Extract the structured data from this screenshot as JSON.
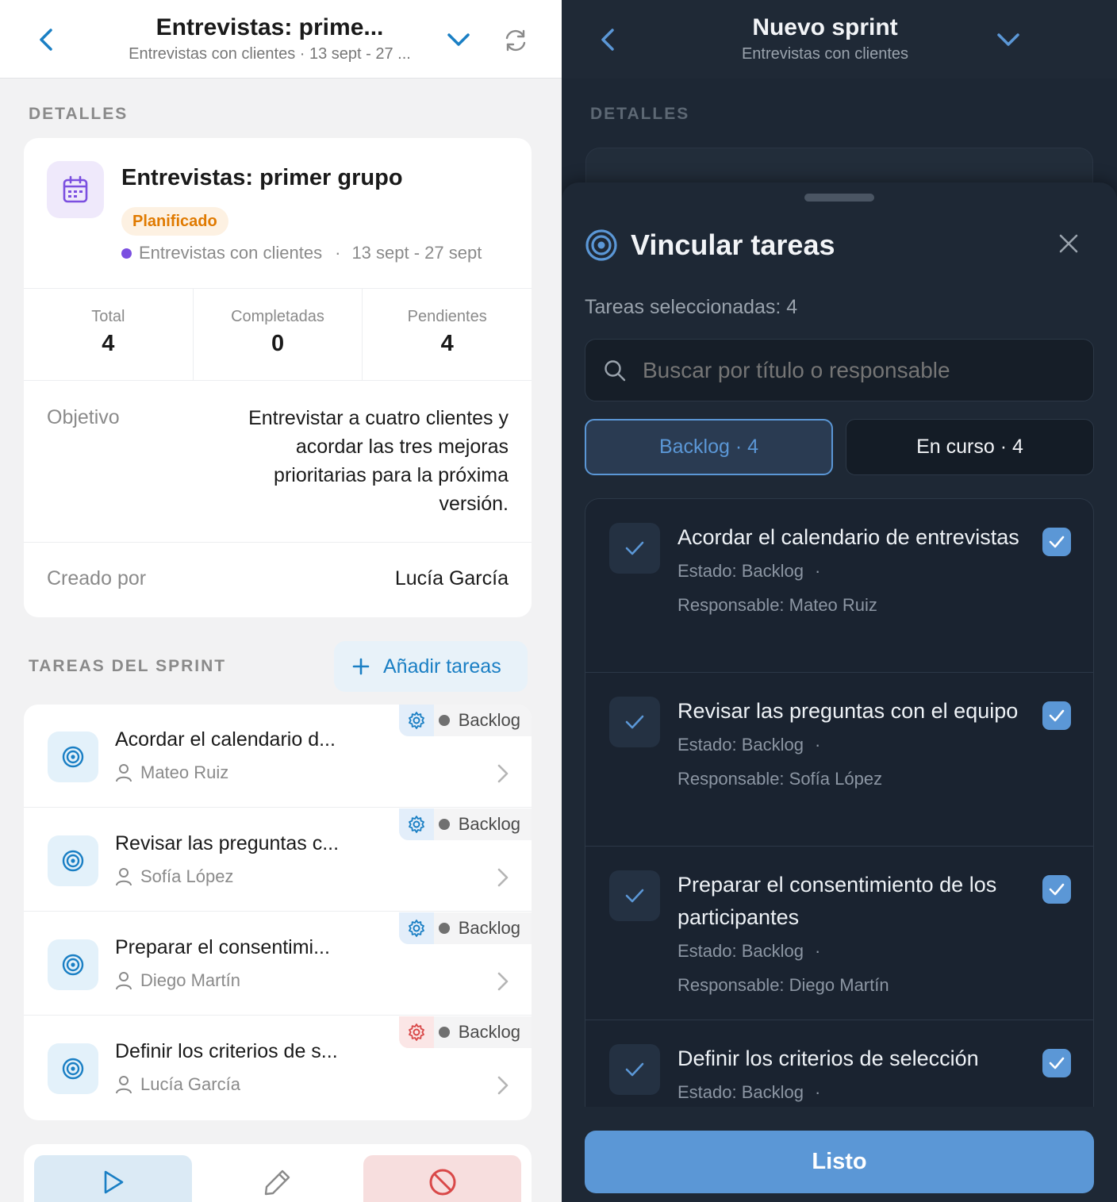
{
  "left": {
    "header": {
      "title": "Entrevistas: prime...",
      "subtitle": "Entrevistas con clientes · 13 sept - 27 ..."
    },
    "details_label": "DETALLES",
    "sprint": {
      "name": "Entrevistas: primer grupo",
      "status": "Planificado",
      "project": "Entrevistas con clientes",
      "separator": "·",
      "dates": "13 sept - 27 sept"
    },
    "stats": [
      {
        "label": "Total",
        "value": "4"
      },
      {
        "label": "Completadas",
        "value": "0"
      },
      {
        "label": "Pendientes",
        "value": "4"
      }
    ],
    "objective": {
      "label": "Objetivo",
      "lines": [
        "Entrevistar a cuatro clientes y",
        "acordar las tres mejoras",
        "prioritarias para la próxima",
        "versión."
      ]
    },
    "creator": {
      "label": "Creado por",
      "value": "Lucía García"
    },
    "tasks_label": "TAREAS DEL SPRINT",
    "add_tasks_label": "Añadir tareas",
    "tasks": [
      {
        "title": "Acordar el calendario d...",
        "assignee": "Mateo Ruiz",
        "status": "Backlog"
      },
      {
        "title": "Revisar las preguntas c...",
        "assignee": "Sofía López",
        "status": "Backlog"
      },
      {
        "title": "Preparar el consentimi...",
        "assignee": "Diego Martín",
        "status": "Backlog"
      },
      {
        "title": "Definir los criterios de s...",
        "assignee": "Lucía García",
        "status": "Backlog"
      }
    ]
  },
  "right": {
    "header": {
      "title": "Nuevo sprint",
      "subtitle": "Entrevistas con clientes"
    },
    "details_label": "DETALLES",
    "sheet": {
      "title": "Vincular tareas",
      "selected_count": "Tareas seleccionadas: 4",
      "search_placeholder": "Buscar por título o responsable",
      "tabs": [
        {
          "label": "Backlog · 4",
          "active": true
        },
        {
          "label": "En curso · 4",
          "active": false
        }
      ],
      "items": [
        {
          "title": "Acordar el calendario de entrevistas",
          "state": "Estado: Backlog",
          "dot": "·",
          "assignee": "Responsable: Mateo Ruiz",
          "checked": true
        },
        {
          "title": "Revisar las preguntas con el equipo",
          "state": "Estado: Backlog",
          "dot": "·",
          "assignee": "Responsable: Sofía López",
          "checked": true
        },
        {
          "title": "Preparar el consentimiento de los participantes",
          "state": "Estado: Backlog",
          "dot": "·",
          "assignee": "Responsable: Diego Martín",
          "checked": true
        },
        {
          "title": "Definir los criterios de selección",
          "state": "Estado: Backlog",
          "dot": "·",
          "assignee": "",
          "checked": true
        }
      ],
      "done_label": "Listo"
    }
  },
  "colors": {
    "accent": "#1a7fc4",
    "dark_bg": "#1d2734",
    "status_orange": "#e07a00",
    "primary_button": "#5b97d6",
    "project_dot": "#7b4fe0"
  }
}
